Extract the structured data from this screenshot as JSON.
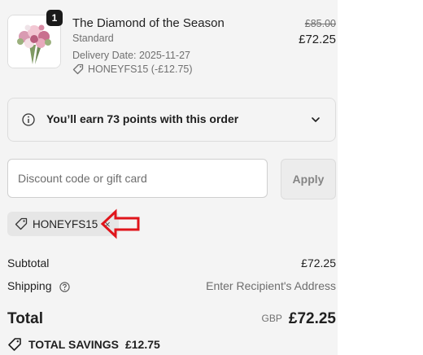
{
  "product": {
    "quantity": "1",
    "name": "The Diamond of the Season",
    "variant": "Standard",
    "delivery_date": "Delivery Date: 2025-11-27",
    "discount_applied": "HONEYFS15 (-£12.75)",
    "original_price": "£85.00",
    "price": "£72.25",
    "image_icon": "flower-bouquet-icon"
  },
  "points_banner": {
    "text": "You’ll earn 73 points with this order",
    "icon": "info-icon",
    "toggle_icon": "chevron-down-icon"
  },
  "discount": {
    "placeholder": "Discount code or gift card",
    "value": "",
    "apply_label": "Apply",
    "applied_code": "HONEYFS15"
  },
  "summary": {
    "subtotal_label": "Subtotal",
    "subtotal_value": "£72.25",
    "shipping_label": "Shipping",
    "shipping_value": "Enter Recipient's Address",
    "total_label": "Total",
    "currency": "GBP",
    "total_value": "£72.25",
    "savings_label": "TOTAL SAVINGS",
    "savings_value": "£12.75"
  },
  "colors": {
    "panel_bg": "#f4f4f4",
    "annotation_arrow": "#e0151b"
  }
}
